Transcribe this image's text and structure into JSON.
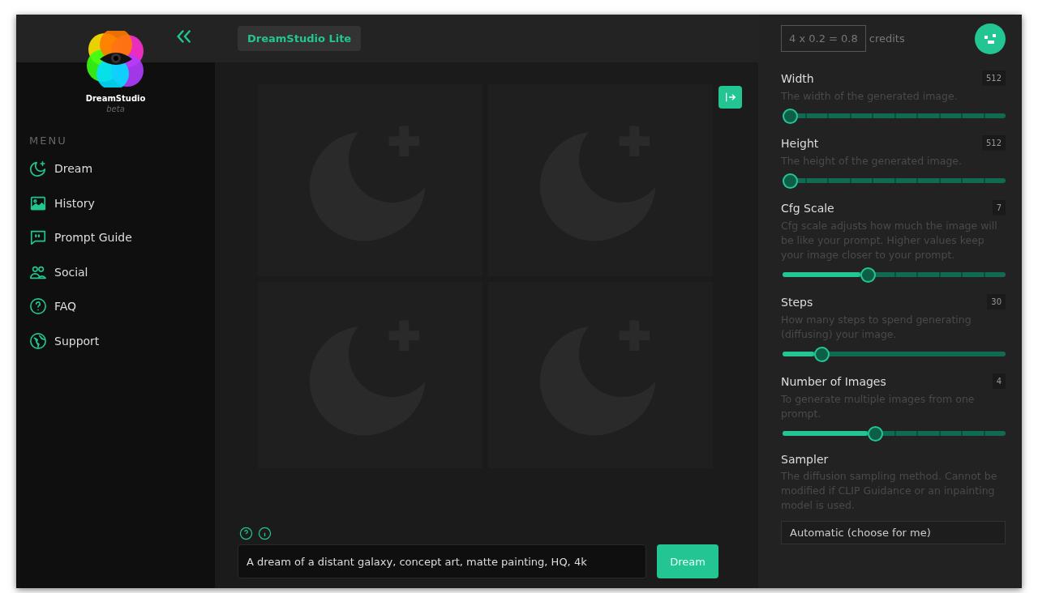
{
  "sidebar": {
    "brand": "DreamStudio",
    "tag": "beta",
    "menu_label": "MENU",
    "items": [
      {
        "label": "Dream",
        "kind": "dream",
        "selected": false
      },
      {
        "label": "History",
        "kind": "history",
        "selected": false
      },
      {
        "label": "Prompt Guide",
        "kind": "guide",
        "selected": false
      },
      {
        "label": "Social",
        "kind": "social",
        "selected": false
      },
      {
        "label": "FAQ",
        "kind": "faq",
        "selected": false
      },
      {
        "label": "Support",
        "kind": "support",
        "selected": false
      }
    ]
  },
  "header": {
    "title": "DreamStudio Lite"
  },
  "credits": {
    "formula": "4 x 0.2 = 0.8",
    "label": "credits"
  },
  "prompt": {
    "value": "A dream of a distant galaxy, concept art, matte painting, HQ, 4k",
    "button": "Dream"
  },
  "settings": [
    {
      "kind": "stepped",
      "label": "Width",
      "value": "512",
      "description": "The width of the generated image.",
      "level": 0
    },
    {
      "kind": "stepped",
      "label": "Height",
      "value": "512",
      "description": "The height of the generated image.",
      "level": 0
    },
    {
      "kind": "stepped",
      "label": "Cfg Scale",
      "value": "7",
      "description": "Cfg scale adjusts how much the image will be like your prompt. Higher values keep your image closer to your prompt.",
      "level": 0.35
    },
    {
      "kind": "continuous",
      "label": "Steps",
      "value": "30",
      "description": "How many steps to spend generating (diffusing) your image.",
      "level": 0.14
    },
    {
      "kind": "stepped",
      "label": "Number of Images",
      "value": "4",
      "description": "To generate multiple images from one prompt.",
      "level": 0.38
    },
    {
      "kind": "select",
      "label": "Sampler",
      "description": "The diffusion sampling method. Cannot be modified if CLIP Guidance or an inpainting model is used.",
      "value": "Automatic (choose for me)"
    }
  ]
}
